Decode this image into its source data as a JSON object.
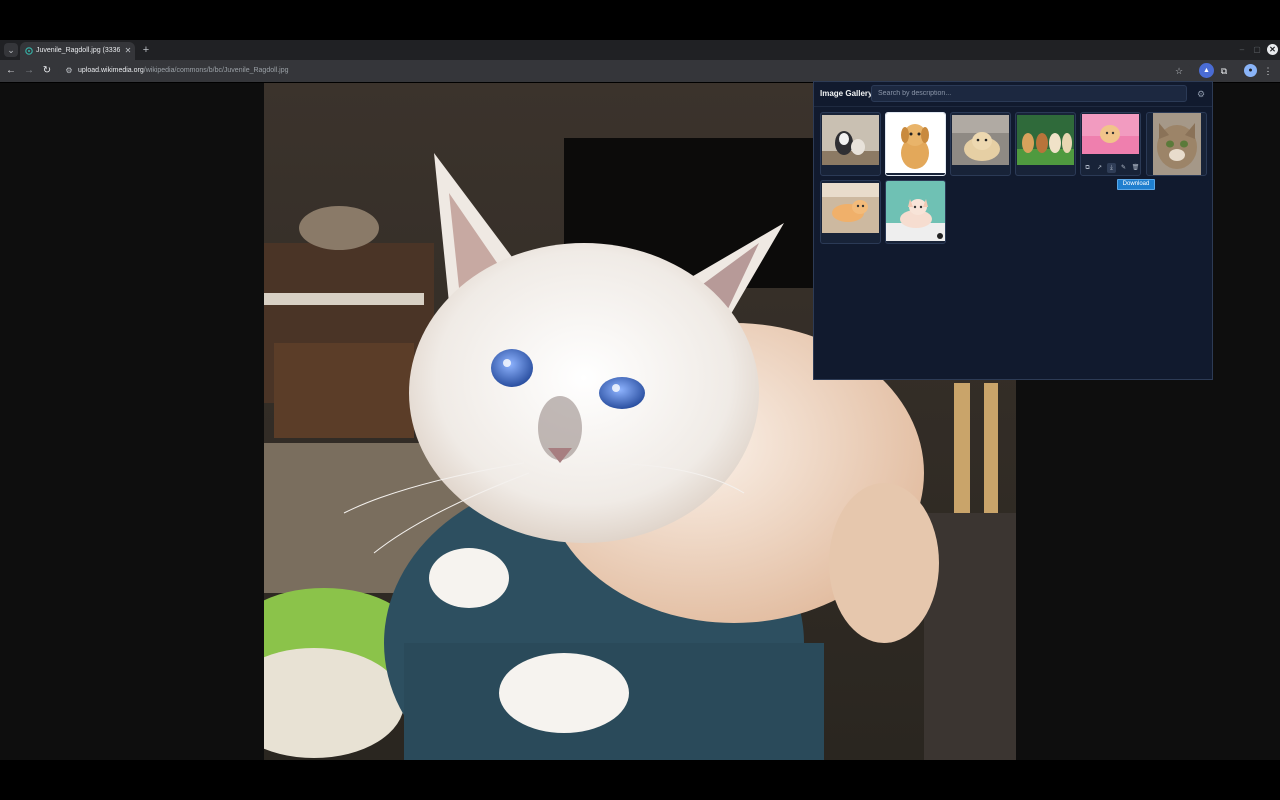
{
  "tab": {
    "title": "Juvenile_Ragdoll.jpg (3336×",
    "close_glyph": "✕",
    "new_tab_glyph": "+"
  },
  "window_controls": {
    "minimize": "–",
    "maximize": "▢",
    "close": "✕"
  },
  "address_bar": {
    "host": "upload.wikimedia.org",
    "path": "/wikipedia/commons/b/bc/Juvenile_Ragdoll.jpg"
  },
  "page_image": {
    "subject": "white ragdoll kitten with blue eyes"
  },
  "gallery": {
    "title": "Image Gallery",
    "search_placeholder": "Search by description...",
    "tooltip": "Download",
    "thumbnails": [
      {
        "subject": "husky puppy and kitten"
      },
      {
        "subject": "golden retriever puppy sitting"
      },
      {
        "subject": "labrador puppy lying"
      },
      {
        "subject": "three puppies on grass"
      },
      {
        "subject": "orange kitten in pink blanket"
      },
      {
        "subject": "tabby cat close-up"
      },
      {
        "subject": "orange kitten lying"
      },
      {
        "subject": "cream kitten on teal background"
      }
    ]
  },
  "icons": {
    "tab_search": "chevron-down-icon",
    "back": "arrow-left-icon",
    "forward": "arrow-right-icon",
    "reload": "reload-icon",
    "site_info": "tune-icon",
    "bookmark": "star-icon",
    "extension_active": "gallery-extension-icon",
    "extensions": "puzzle-icon",
    "profile": "profile-icon",
    "menu": "kebab-menu-icon",
    "gallery_settings": "settings-icon",
    "thumb_actions": [
      "copy-icon",
      "open-external-icon",
      "download-icon",
      "edit-icon",
      "trash-icon"
    ]
  },
  "colors": {
    "chrome_bg": "#202124",
    "toolbar_bg": "#35363a",
    "panel_bg": "#111a2e",
    "tooltip_bg": "#1f7fcf"
  }
}
